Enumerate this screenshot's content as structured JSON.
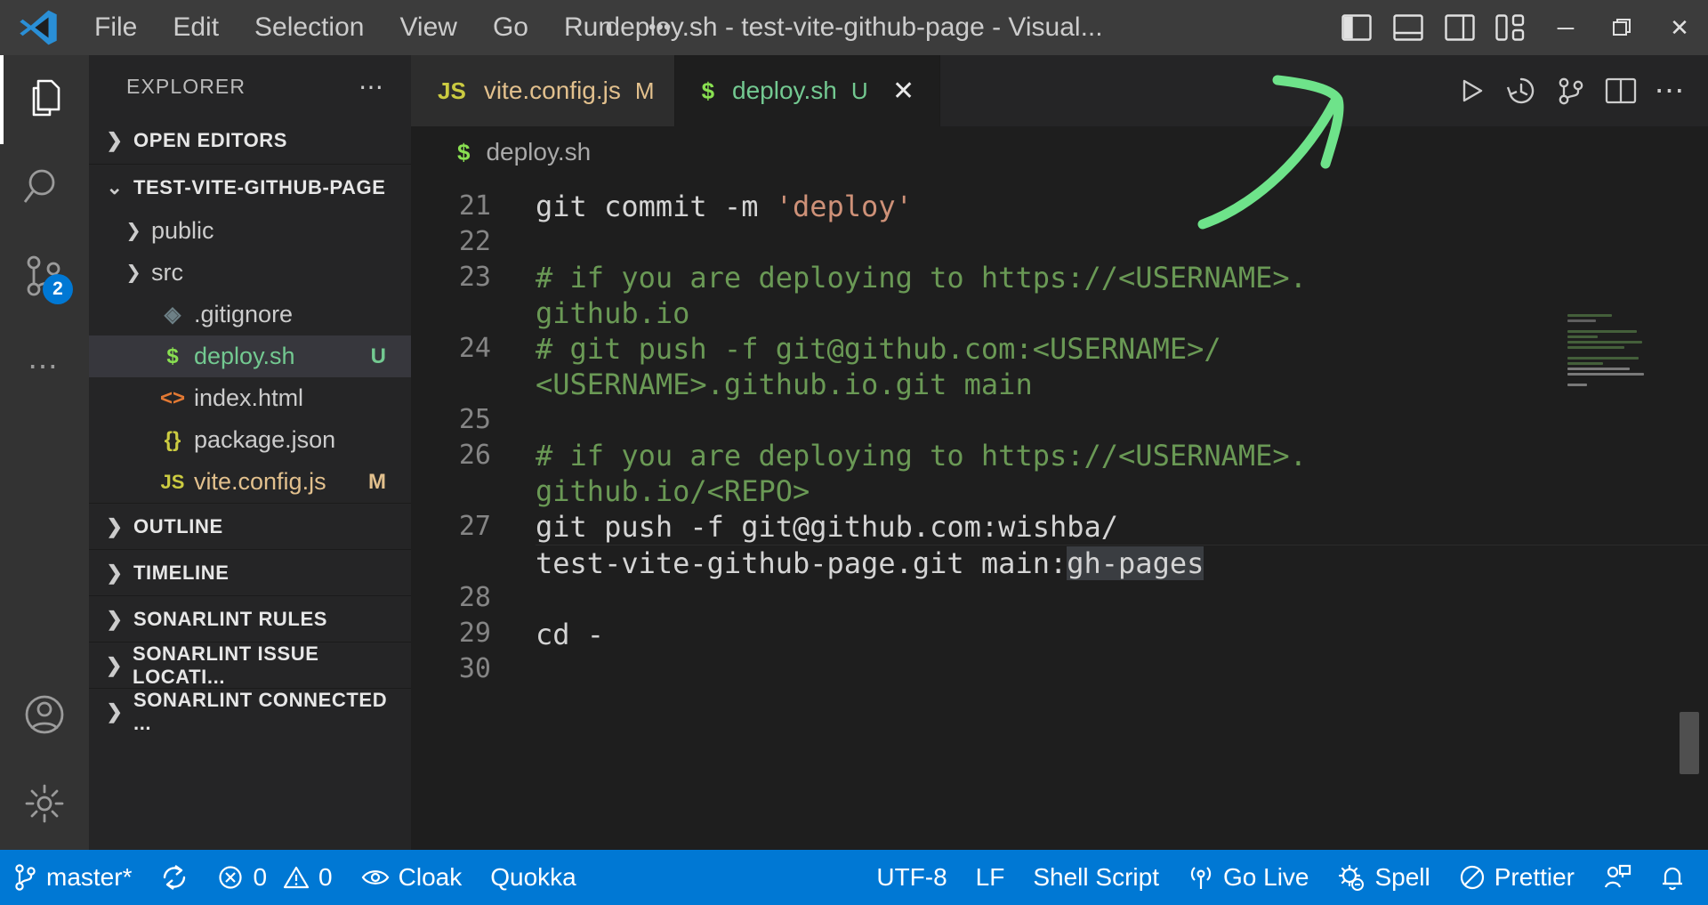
{
  "titlebar": {
    "logo_icon": "vscode-logo-icon",
    "menus": [
      {
        "label": "File",
        "name": "menu-file"
      },
      {
        "label": "Edit",
        "name": "menu-edit"
      },
      {
        "label": "Selection",
        "name": "menu-selection"
      },
      {
        "label": "View",
        "name": "menu-view"
      },
      {
        "label": "Go",
        "name": "menu-go"
      },
      {
        "label": "Run",
        "name": "menu-run"
      },
      {
        "label": "•••",
        "name": "menu-more"
      }
    ],
    "window_title": "deploy.sh - test-vite-github-page - Visual...",
    "layout_buttons": [
      {
        "name": "toggle-primary-sidebar-icon"
      },
      {
        "name": "toggle-panel-icon"
      },
      {
        "name": "toggle-secondary-sidebar-icon"
      },
      {
        "name": "customize-layout-icon"
      }
    ],
    "window_controls": {
      "minimize": "─",
      "maximize": "❐",
      "close": "✕"
    }
  },
  "activitybar": {
    "items": [
      {
        "name": "activity-explorer",
        "icon": "files-icon",
        "active": true,
        "badge": null
      },
      {
        "name": "activity-search",
        "icon": "search-icon",
        "active": false,
        "badge": null
      },
      {
        "name": "activity-source-control",
        "icon": "source-control-icon",
        "active": false,
        "badge": "2"
      },
      {
        "name": "activity-more",
        "icon": "ellipsis-icon",
        "active": false,
        "badge": null
      }
    ],
    "bottom_items": [
      {
        "name": "activity-accounts",
        "icon": "account-icon"
      },
      {
        "name": "activity-settings",
        "icon": "gear-icon"
      }
    ],
    "badge_color": "#0078d4"
  },
  "sidebar": {
    "title": "EXPLORER",
    "more_actions": "…",
    "sections": [
      {
        "name": "section-open-editors",
        "label": "OPEN EDITORS",
        "expanded": false
      },
      {
        "name": "section-workspace",
        "label": "TEST-VITE-GITHUB-PAGE",
        "expanded": true
      }
    ],
    "files": [
      {
        "name": "tree-item-public",
        "label": "public",
        "type": "folder",
        "icon": "folder-icon",
        "icon_text": "",
        "icon_color": "#cccccc",
        "text_color": "#cccccc",
        "badge": "",
        "badge_color": "",
        "selected": false,
        "expandable": true
      },
      {
        "name": "tree-item-src",
        "label": "src",
        "type": "folder",
        "icon": "folder-icon",
        "icon_text": "",
        "icon_color": "#cccccc",
        "text_color": "#cccccc",
        "badge": "",
        "badge_color": "",
        "selected": false,
        "expandable": true
      },
      {
        "name": "tree-item-gitignore",
        "label": ".gitignore",
        "type": "file",
        "icon": "git-icon",
        "icon_text": "◈",
        "icon_color": "#6d8086",
        "text_color": "#cccccc",
        "badge": "",
        "badge_color": "",
        "selected": false,
        "expandable": false
      },
      {
        "name": "tree-item-deploy-sh",
        "label": "deploy.sh",
        "type": "file",
        "icon": "shell-icon",
        "icon_text": "$",
        "icon_color": "#89e051",
        "text_color": "#73c991",
        "badge": "U",
        "badge_color": "#73c991",
        "selected": true,
        "expandable": false
      },
      {
        "name": "tree-item-index-html",
        "label": "index.html",
        "type": "file",
        "icon": "html-icon",
        "icon_text": "<>",
        "icon_color": "#e37933",
        "text_color": "#cccccc",
        "badge": "",
        "badge_color": "",
        "selected": false,
        "expandable": false
      },
      {
        "name": "tree-item-package-json",
        "label": "package.json",
        "type": "file",
        "icon": "json-icon",
        "icon_text": "{}",
        "icon_color": "#cbcb41",
        "text_color": "#cccccc",
        "badge": "",
        "badge_color": "",
        "selected": false,
        "expandable": false
      },
      {
        "name": "tree-item-vite-config-js",
        "label": "vite.config.js",
        "type": "file",
        "icon": "js-icon",
        "icon_text": "JS",
        "icon_color": "#cbcb41",
        "text_color": "#e2c08d",
        "badge": "M",
        "badge_color": "#e2c08d",
        "selected": false,
        "expandable": false
      }
    ],
    "bottom_sections": [
      {
        "name": "section-outline",
        "label": "OUTLINE"
      },
      {
        "name": "section-timeline",
        "label": "TIMELINE"
      },
      {
        "name": "section-sonarlint-rules",
        "label": "SONARLINT RULES"
      },
      {
        "name": "section-sonarlint-issue-locations",
        "label": "SONARLINT ISSUE LOCATI..."
      },
      {
        "name": "section-sonarlint-connected",
        "label": "SONARLINT CONNECTED ..."
      }
    ]
  },
  "editor": {
    "tabs": [
      {
        "name": "tab-vite-config-js",
        "label": "vite.config.js",
        "icon_text": "JS",
        "icon_color": "#cbcb41",
        "text_color": "#e2c08d",
        "badge": "M",
        "active": false,
        "closable": false
      },
      {
        "name": "tab-deploy-sh",
        "label": "deploy.sh",
        "icon_text": "$",
        "icon_color": "#89e051",
        "text_color": "#73c991",
        "badge": "U",
        "active": true,
        "closable": true
      }
    ],
    "tab_close_glyph": "✕",
    "tab_actions": [
      {
        "name": "run-code-button",
        "icon": "play-icon"
      },
      {
        "name": "timeline-history-button",
        "icon": "history-icon"
      },
      {
        "name": "source-control-graph-button",
        "icon": "git-compare-icon"
      },
      {
        "name": "split-editor-button",
        "icon": "split-editor-icon"
      },
      {
        "name": "editor-more-actions-button",
        "icon": "ellipsis-icon"
      }
    ],
    "breadcrumb": {
      "icon_text": "$",
      "icon_color": "#89e051",
      "label": "deploy.sh"
    },
    "lines": [
      {
        "number": "21",
        "segments": [
          {
            "text": "git commit -m ",
            "cls": "c-plain"
          },
          {
            "text": "'deploy'",
            "cls": "c-str"
          }
        ],
        "wrapped": []
      },
      {
        "number": "22",
        "segments": [],
        "wrapped": []
      },
      {
        "number": "23",
        "segments": [
          {
            "text": "# if you are deploying to https://<USERNAME>.",
            "cls": "c-comment"
          }
        ],
        "wrapped": [
          {
            "text": "github.io",
            "cls": "c-comment"
          }
        ]
      },
      {
        "number": "24",
        "segments": [
          {
            "text": "# git push -f git@github.com:<USERNAME>/",
            "cls": "c-comment"
          }
        ],
        "wrapped": [
          {
            "text": "<USERNAME>.github.io.git main",
            "cls": "c-comment"
          }
        ]
      },
      {
        "number": "25",
        "segments": [],
        "wrapped": []
      },
      {
        "number": "26",
        "segments": [
          {
            "text": "# if you are deploying to https://<USERNAME>.",
            "cls": "c-comment"
          }
        ],
        "wrapped": [
          {
            "text": "github.io/<REPO>",
            "cls": "c-comment"
          }
        ]
      },
      {
        "number": "27",
        "segments": [
          {
            "text": "git push -f git@github.com:wishba/",
            "cls": "c-plain"
          }
        ],
        "wrapped": [
          {
            "text": "test-vite-github-page.git main:",
            "cls": "c-plain"
          },
          {
            "text": "gh-pages",
            "cls": "c-plain sel"
          }
        ]
      },
      {
        "number": "28",
        "segments": [],
        "wrapped": []
      },
      {
        "number": "29",
        "segments": [
          {
            "text": "cd -",
            "cls": "c-plain"
          }
        ],
        "wrapped": []
      },
      {
        "number": "30",
        "segments": [],
        "wrapped": []
      }
    ]
  },
  "statusbar": {
    "background": "#0078d4",
    "left_items": [
      {
        "name": "status-branch",
        "icon": "source-control-icon",
        "label": "master*"
      },
      {
        "name": "status-sync",
        "icon": "sync-icon",
        "label": ""
      },
      {
        "name": "status-problems",
        "icon": "error-warning-icon",
        "label": "0",
        "label2": "0"
      },
      {
        "name": "status-cloak",
        "icon": "eye-icon",
        "label": "Cloak"
      },
      {
        "name": "status-quokka",
        "icon": "",
        "label": "Quokka"
      }
    ],
    "right_items": [
      {
        "name": "status-encoding",
        "icon": "",
        "label": "UTF-8"
      },
      {
        "name": "status-eol",
        "icon": "",
        "label": "LF"
      },
      {
        "name": "status-language-mode",
        "icon": "",
        "label": "Shell Script"
      },
      {
        "name": "status-go-live",
        "icon": "broadcast-icon",
        "label": "Go Live"
      },
      {
        "name": "status-spell",
        "icon": "spell-icon",
        "label": "Spell"
      },
      {
        "name": "status-prettier",
        "icon": "prettier-icon",
        "label": "Prettier"
      },
      {
        "name": "status-live-share",
        "icon": "live-share-icon",
        "label": ""
      },
      {
        "name": "status-notifications",
        "icon": "bell-icon",
        "label": ""
      }
    ]
  },
  "annotation": {
    "arrow_color": "#6ee38a",
    "arrow_name": "green-annotation-arrow"
  }
}
